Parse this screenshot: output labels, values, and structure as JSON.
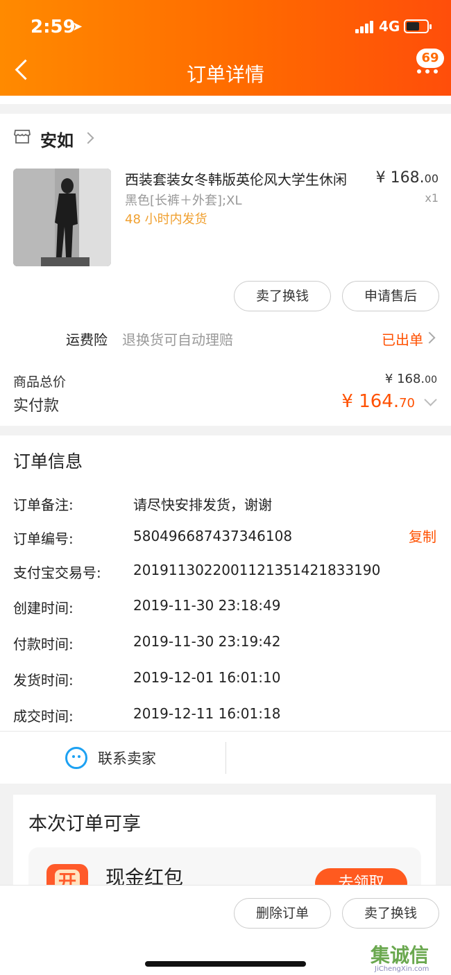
{
  "status_bar": {
    "time": "2:59",
    "network": "4G"
  },
  "nav": {
    "title": "订单详情",
    "badge": "69"
  },
  "shop": {
    "name": "安如"
  },
  "product": {
    "title": "西装套装女冬韩版英伦风大学生休闲",
    "spec": "黑色[长裤＋外套];XL",
    "shipping": "48 小时内发货",
    "price_main": "¥ 168.",
    "price_cents": "00",
    "qty": "x1"
  },
  "buttons": {
    "sell": "卖了换钱",
    "after_sale": "申请售后",
    "delete": "删除订单",
    "sell_bottom": "卖了换钱"
  },
  "insurance": {
    "label": "运费险",
    "desc": "退换货可自动理赔",
    "status": "已出单"
  },
  "totals": {
    "goods_label": "商品总价",
    "goods_main": "¥ 168.",
    "goods_cents": "00",
    "paid_label": "实付款",
    "paid_main": "¥ 164.",
    "paid_cents": "70"
  },
  "order_info": {
    "title": "订单信息",
    "copy_label": "复制",
    "rows": [
      {
        "label": "订单备注:",
        "value": "请尽快安排发货，谢谢"
      },
      {
        "label": "订单编号:",
        "value": "580496687437346108"
      },
      {
        "label": "支付宝交易号:",
        "value": "2019113022001121351421833190"
      },
      {
        "label": "创建时间:",
        "value": "2019-11-30 23:18:49"
      },
      {
        "label": "付款时间:",
        "value": "2019-11-30 23:19:42"
      },
      {
        "label": "发货时间:",
        "value": "2019-12-01 16:01:10"
      },
      {
        "label": "成交时间:",
        "value": "2019-12-11 16:01:18"
      }
    ]
  },
  "contact": {
    "label": "联系卖家"
  },
  "benefits": {
    "title": "本次订单可享",
    "item_name": "现金红包",
    "item_button": "去领取"
  },
  "watermark": {
    "text": "集诚信",
    "site": "JiChengXin.com"
  },
  "colors": {
    "accent": "#ff5000",
    "header_start": "#ff8a00",
    "header_end": "#ff4e0a",
    "shipping": "#f0a030",
    "contact_icon": "#1da1f2"
  }
}
